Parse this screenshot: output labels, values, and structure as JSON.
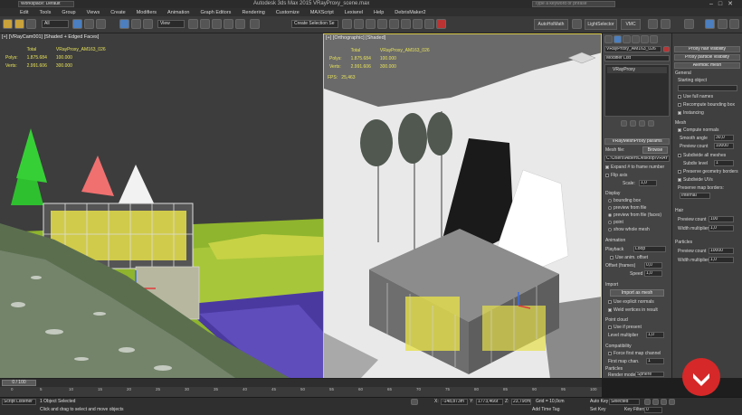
{
  "window": {
    "title": "Autodesk 3ds Max 2015   VRayProxy_scene.max",
    "workspace": "Workspace: Default",
    "search_placeholder": "Type a keyword or phrase"
  },
  "menu": [
    "Edit",
    "Tools",
    "Group",
    "Views",
    "Create",
    "Modifiers",
    "Animation",
    "Graph Editors",
    "Rendering",
    "Customize",
    "MAXScript",
    "Lexiwrel",
    "Help",
    "DebrisMaker2"
  ],
  "toolbar": {
    "filter": "All",
    "view_dropdown": "View",
    "selection_set": "Create Selection Se",
    "btn_autoholmath": "AutoHolMath",
    "btn_lightselect": "LightSelector",
    "btn_vmc": "VMC"
  },
  "viewport_left": {
    "label": "[+] [VRayCam001] [Shaded + Edged Faces]",
    "stats": [
      {
        "name": "",
        "total": "Total",
        "obj": "VRayProxy_AM163_026"
      },
      {
        "name": "Polys:",
        "total": "1.875.684",
        "obj": "100.000"
      },
      {
        "name": "Verts:",
        "total": "2.991.606",
        "obj": "300.000"
      }
    ]
  },
  "viewport_right": {
    "label": "[+] [Orthographic] [Shaded]",
    "stats": [
      {
        "name": "",
        "total": "Total",
        "obj": "VRayProxy_AM163_026"
      },
      {
        "name": "Polys:",
        "total": "1.875.684",
        "obj": "100.000"
      },
      {
        "name": "Verts:",
        "total": "2.991.606",
        "obj": "300.000"
      }
    ],
    "fps_label": "FPS:",
    "fps_value": "25,463"
  },
  "command_panel": {
    "object_name": "VRayProxy_AM163_026",
    "modifier_list": "Modifier List",
    "stack_item": "VRayProxy",
    "params_header": "VRayMeshProxy params",
    "mesh_file_label": "Mesh file:",
    "browse": "Browse",
    "mesh_file_path": "C:\\Users\\Albert\\Desktop\\VRAY",
    "expand_frame": "Expand # to frame number",
    "flip_axis": "Flip axis",
    "scale_label": "Scale:",
    "scale_value": "1,0",
    "display_label": "Display",
    "display_options": [
      {
        "label": "bounding box",
        "on": false
      },
      {
        "label": "preview from file",
        "on": false
      },
      {
        "label": "preview from file (faces)",
        "on": true
      },
      {
        "label": "point",
        "on": false
      },
      {
        "label": "show whole mesh",
        "on": false
      }
    ],
    "animation_label": "Animation",
    "playback_label": "Playback",
    "playback_value": "Loop",
    "use_anim_offset": "Use anim. offset",
    "offset_label": "Offset (frames)",
    "offset_value": "0,0",
    "speed_label": "Speed",
    "speed_value": "1,0",
    "import_label": "Import",
    "import_as_mesh": "Import as mesh",
    "use_explicit_normals": "Use explicit normals",
    "weld_vertices": "Weld vertices in result",
    "point_cloud_label": "Point cloud",
    "use_if_present": "Use if present",
    "level_mult_label": "Level multiplier",
    "level_mult_value": "1,0",
    "compat_label": "Compatibility",
    "force_first": "Force first map channel",
    "first_map_label": "First map chan.",
    "first_map_value": "1",
    "particles_label": "Particles",
    "render_mode_label": "Render mode:",
    "render_mode_value": "Sphere"
  },
  "rollout": {
    "hair_vis": "Proxy hair visibility",
    "particle_vis": "Proxy particle visibility",
    "alembic_header": "Alembic mesh",
    "general_label": "General",
    "starting_object": "Starting object",
    "use_full_names": "Use full names",
    "recompute_bbox": "Recompute bounding box",
    "instancing": "Instancing",
    "mesh_label": "Mesh",
    "compute_normals": "Compute normals",
    "smooth_angle_label": "Smooth angle",
    "smooth_angle_value": "30,0",
    "preview_count_label": "Preview count",
    "preview_count_value": "10000",
    "subdivide_all": "Subdivide all meshes",
    "subdiv_level_label": "Subdiv level",
    "subdiv_level_value": "1",
    "preserve_geom": "Preserve geometry borders",
    "subdivide_uvs": "Subdivide UVs",
    "preserve_map_label": "Preserve map borders:",
    "preserve_map_value": "Internal",
    "hair_label": "Hair",
    "hair_preview_label": "Preview count",
    "hair_preview_value": "100",
    "hair_width_label": "Width multiplier",
    "hair_width_value": "1,0",
    "particles_label": "Particles",
    "part_preview_label": "Preview count",
    "part_preview_value": "10000",
    "part_width_label": "Width multiplier",
    "part_width_value": "1,0"
  },
  "timeline": {
    "frame": "0 / 100",
    "ticks": [
      "0",
      "5",
      "10",
      "15",
      "20",
      "25",
      "30",
      "35",
      "40",
      "45",
      "50",
      "55",
      "60",
      "65",
      "70",
      "75",
      "80",
      "85",
      "90",
      "95",
      "100"
    ],
    "progress": 0.0
  },
  "status": {
    "script_listener": "Script Listener",
    "selected": "1 Object Selected",
    "prompt": "Click and drag to select and move objects",
    "x_label": "X:",
    "x_value": "-148,873m",
    "y_label": "Y:",
    "y_value": "1773,466t",
    "z_label": "Z:",
    "z_value": "23,79cm",
    "grid": "Grid = 10,0cm",
    "add_time_tag": "Add Time Tag",
    "auto_key": "Auto Key",
    "selected_filter": "Selected",
    "set_key": "Set Key",
    "key_filters": "Key Filters...",
    "frame_value": "0"
  },
  "colors": {
    "accent_blue": "#4b7fc0",
    "active_viewport_border": "#d9c94a",
    "stat_yellow": "#e9e45a",
    "logo_red": "#d62828"
  }
}
